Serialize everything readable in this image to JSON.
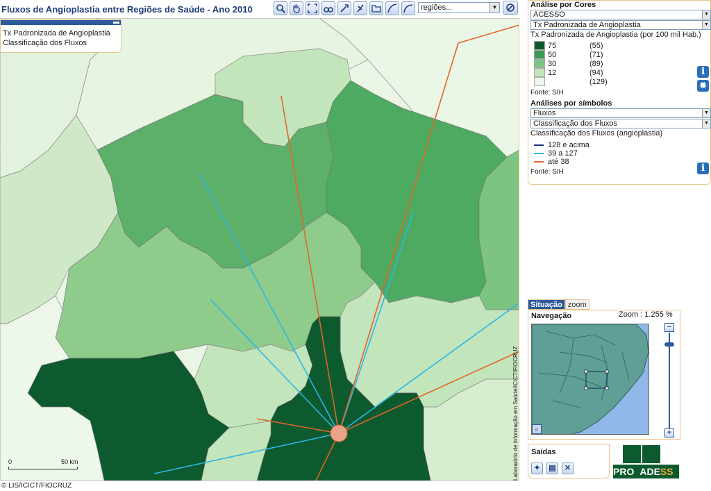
{
  "title": "Fluxos de Angioplastia entre Regiões de Saúde - Ano 2010",
  "toolbar": {
    "tools": [
      "zoom-in-icon",
      "pan-hand-icon",
      "zoom-extent-icon",
      "binoculars-icon",
      "identify-icon",
      "pointer-icon",
      "folder-icon",
      "curve-icon",
      "arc-icon"
    ],
    "region_select": "regiões...",
    "clear": "clear-icon"
  },
  "map_legend": {
    "line1": "Tx Padronizada de Angioplastia",
    "line2": "Classificação dos Fluxos",
    "collapse": "▬"
  },
  "scale": {
    "start": "0",
    "end": "50 km"
  },
  "credit": "© LIS/ICICT/FIOCRUZ",
  "vertical_credit": "Laboratório de Informação em Saúde/ICICT/FIOCRUZ",
  "panel": {
    "colors_header": "Análise por Cores",
    "colors_select1": "ACESSO",
    "colors_select2": "Tx Padronizada de Angioplastia",
    "colors_title": "Tx Padronizada de Angioplastia (por 100 mil Hab.)",
    "classes": [
      {
        "label": "75",
        "count": "(55)",
        "color": "#0d5a2e"
      },
      {
        "label": "50",
        "count": "(71)",
        "color": "#3a9b55"
      },
      {
        "label": "30",
        "count": "(89)",
        "color": "#7cc47f"
      },
      {
        "label": "12",
        "count": "(94)",
        "color": "#c3e5bb"
      },
      {
        "label": "",
        "count": "(129)",
        "color": "#eef7ea"
      }
    ],
    "source1": "Fonte: SIH",
    "symbols_header": "Análises por símbolos",
    "symbols_select1": "Fluxos",
    "symbols_select2": "Classificação dos Fluxos",
    "symbols_title": "Classificação dos Fluxos (angioplastia)",
    "flows": [
      {
        "label": "128 e acima",
        "color": "#1b2f7a"
      },
      {
        "label": "39 a 127",
        "color": "#2bb6e6"
      },
      {
        "label": "até 38",
        "color": "#e0652b"
      }
    ],
    "source2": "Fonte: SIH"
  },
  "nav": {
    "tab_active": "Situação",
    "tab_inactive": "zoom",
    "header": "Navegação",
    "zoom": "Zoom : 1.255 %",
    "plus": "+",
    "minus": "−"
  },
  "saidas": {
    "header": "Saídas"
  },
  "logo": {
    "text1": "PRO",
    "text2": "ADE",
    "text3": "SS"
  }
}
